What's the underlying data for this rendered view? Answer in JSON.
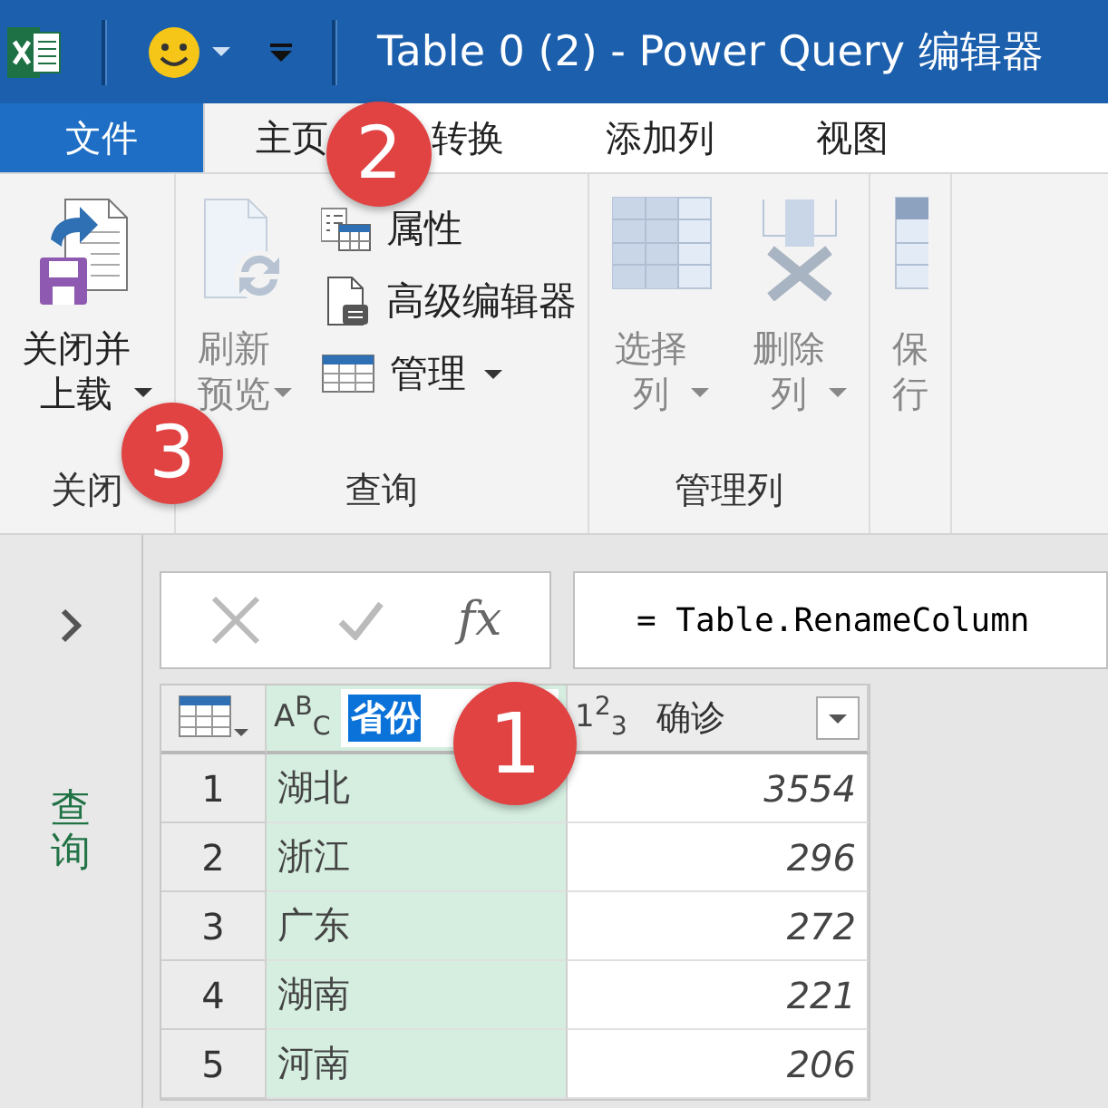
{
  "title_bar": {
    "title": "Table 0 (2) - Power Query 编辑器"
  },
  "tabs": [
    {
      "label": "文件",
      "kind": "file",
      "selected": false
    },
    {
      "label": "主页",
      "kind": "tab",
      "selected": true
    },
    {
      "label": "转换",
      "kind": "tab",
      "selected": false
    },
    {
      "label": "添加列",
      "kind": "tab",
      "selected": false
    },
    {
      "label": "视图",
      "kind": "tab",
      "selected": false
    }
  ],
  "ribbon_groups": [
    {
      "label": "关闭",
      "items": [
        {
          "kind": "large",
          "label": "关闭并上载",
          "dropdown": true,
          "disabled": false
        }
      ]
    },
    {
      "label": "查询",
      "items": [
        {
          "kind": "large",
          "label": "刷新预览",
          "dropdown": true,
          "disabled": true
        },
        {
          "kind": "small",
          "label": "属性",
          "dropdown": false,
          "disabled": false
        },
        {
          "kind": "small",
          "label": "高级编辑器",
          "dropdown": false,
          "disabled": false
        },
        {
          "kind": "small",
          "label": "管理",
          "dropdown": true,
          "disabled": false
        }
      ]
    },
    {
      "label": "管理列",
      "items": [
        {
          "kind": "large",
          "label": "选择列",
          "dropdown": true,
          "disabled": true
        },
        {
          "kind": "large",
          "label": "删除列",
          "dropdown": true,
          "disabled": true
        }
      ]
    },
    {
      "items": [
        {
          "kind": "large",
          "label": "保行",
          "dropdown": false,
          "disabled": true
        }
      ]
    }
  ],
  "side_panel": {
    "label": "查询"
  },
  "formula_bar": {
    "fx": "fx",
    "formula": "= Table.RenameColumn"
  },
  "table": {
    "columns": [
      {
        "type": "A$^{B}$$_{C}$",
        "name": "省份",
        "kind": "text",
        "selected": true,
        "editing": true
      },
      {
        "type": "1$^{2}$$_{3}$",
        "name": "确诊",
        "kind": "number",
        "selected": false,
        "editing": false
      }
    ],
    "rows": [
      {
        "number": "1",
        "cells": [
          "湖北",
          "3554"
        ]
      },
      {
        "number": "2",
        "cells": [
          "浙江",
          "296"
        ]
      },
      {
        "number": "3",
        "cells": [
          "广东",
          "272"
        ]
      },
      {
        "number": "4",
        "cells": [
          "湖南",
          "221"
        ]
      },
      {
        "number": "5",
        "cells": [
          "河南",
          "206"
        ]
      }
    ]
  },
  "callouts": [
    {
      "label": "1"
    },
    {
      "label": "2"
    },
    {
      "label": "3"
    }
  ]
}
